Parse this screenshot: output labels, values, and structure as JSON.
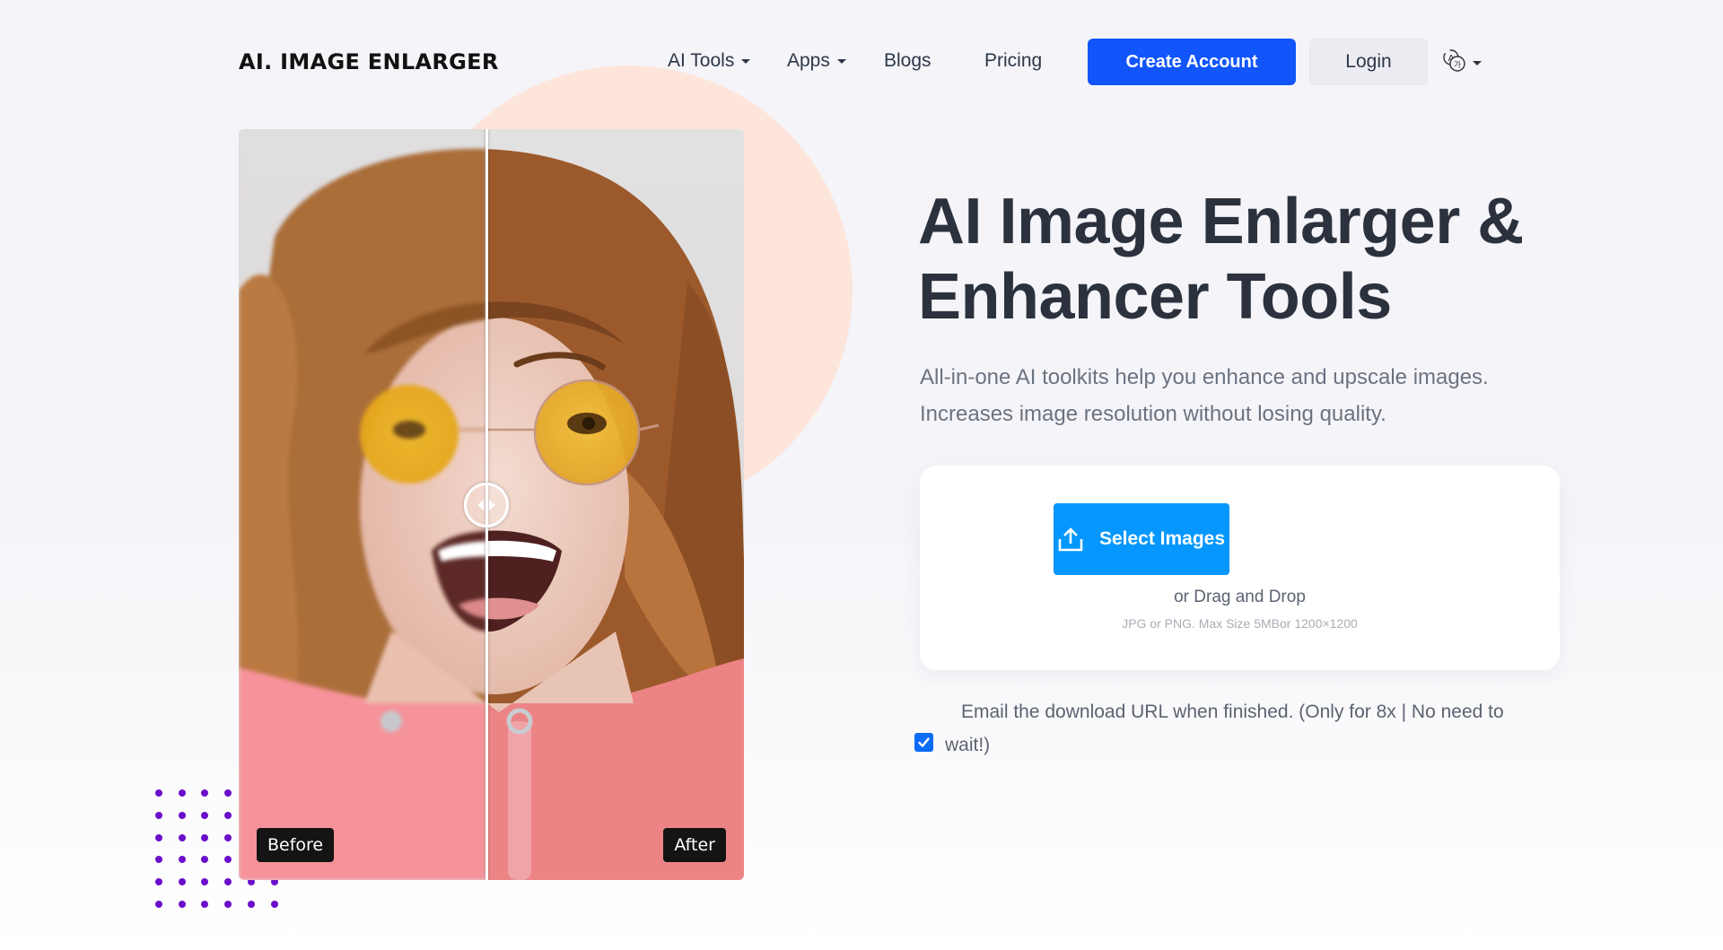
{
  "header": {
    "logo": "AI. IMAGE ENLARGER",
    "nav": [
      {
        "label": "AI Tools",
        "has_dropdown": true
      },
      {
        "label": "Apps",
        "has_dropdown": true
      },
      {
        "label": "Blogs",
        "has_dropdown": false
      },
      {
        "label": "Pricing",
        "has_dropdown": false
      }
    ],
    "create_account_label": "Create Account",
    "login_label": "Login",
    "language_icon": "translate-icon"
  },
  "compare": {
    "before_label": "Before",
    "after_label": "After",
    "slider_position": 0.49
  },
  "hero": {
    "title_line1": "AI Image Enlarger &",
    "title_line2": "Enhancer Tools",
    "subtitle_line1": "All-in-one AI toolkits help you enhance and upscale images.",
    "subtitle_line2": "Increases image resolution without losing quality."
  },
  "upload": {
    "button_label": "Select Images",
    "button_icon": "upload-icon",
    "drag_text": "or Drag and Drop",
    "hint_text": "JPG or PNG. Max Size 5MBor 1200×1200"
  },
  "email_option": {
    "checked": true,
    "line1": "Email the download URL when finished. (Only for 8x | No need to",
    "line2": "wait!)"
  },
  "colors": {
    "primary": "#1155fb",
    "upload_button": "#0597fd",
    "peach": "#fde5dc",
    "dots": "#6a0ecb",
    "heading": "#2c323d"
  }
}
